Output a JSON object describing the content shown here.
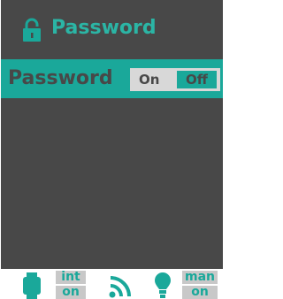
{
  "title": {
    "text": "Password",
    "icon": "lock-icon"
  },
  "password_setting": {
    "label": "Password",
    "toggle": {
      "on_label": "On",
      "off_label": "Off",
      "selected": "Off"
    }
  },
  "status_bar": {
    "watch": {
      "icon": "watch-icon",
      "mode_label": "int",
      "state_label": "on"
    },
    "signal": {
      "icon": "wifi-signal-icon"
    },
    "light": {
      "icon": "bulb-icon",
      "mode_label": "man",
      "state_label": "on"
    }
  },
  "colors": {
    "background": "#484848",
    "accent": "#1aa89a",
    "title_accent": "#2bb5a5",
    "toggle_background": "#d8d8d8",
    "tag_background": "#c8c8c8"
  }
}
